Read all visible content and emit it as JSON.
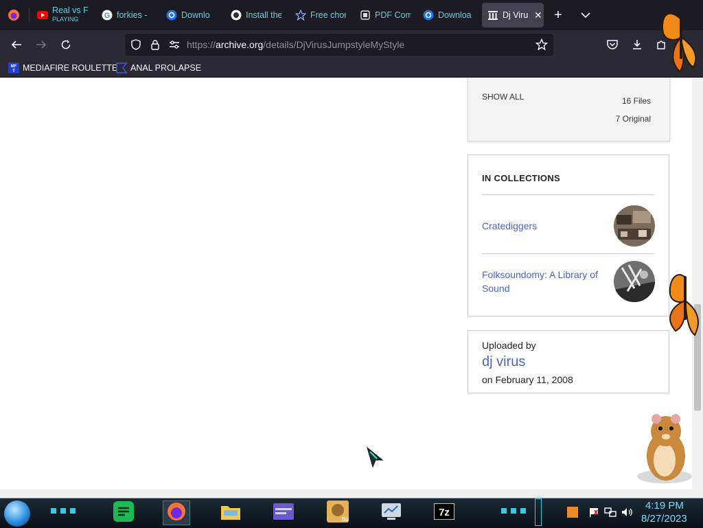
{
  "tabs": [
    {
      "title": "Real vs F",
      "sub": "PLAYING",
      "icon": "youtube-icon"
    },
    {
      "title": "forkies -",
      "icon": "google-icon"
    },
    {
      "title": "Downlo",
      "icon": "download-site-icon"
    },
    {
      "title": "Install the",
      "icon": "install-site-icon"
    },
    {
      "title": "Free chor",
      "icon": "star-site-icon"
    },
    {
      "title": "PDF Com",
      "icon": "pdf-site-icon"
    },
    {
      "title": "Downloa",
      "icon": "download-site-icon"
    },
    {
      "title": "Dj Viru",
      "icon": "archive-icon",
      "active": true
    }
  ],
  "url": {
    "prefix": "https://",
    "host": "archive.org",
    "path": "/details/DjVirusJumpstyleMyStyle"
  },
  "bookmarks": [
    {
      "label": "MEDIAFIRE ROULETTER",
      "icon": "mediafire-icon"
    },
    {
      "label": "ANAL PROLAPSE",
      "icon": "bookmark-site-icon"
    }
  ],
  "files": {
    "show_all": "SHOW ALL",
    "count": "16 Files",
    "original": "7 Original"
  },
  "collections": {
    "title": "IN COLLECTIONS",
    "items": [
      {
        "label": "Cratediggers"
      },
      {
        "label": "Folksoundomy: A Library of Sound"
      }
    ]
  },
  "upload": {
    "label": "Uploaded by",
    "name": "dj virus",
    "date": "on February 11, 2008"
  },
  "clock": {
    "time": "4:19 PM",
    "date": "8/27/2023"
  },
  "colors": {
    "link": "#4b64be",
    "tab_text": "#5fd0e6",
    "clock": "#79d9ff"
  }
}
